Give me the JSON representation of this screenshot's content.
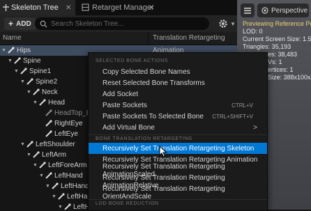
{
  "tabs": [
    {
      "label": "Skeleton Tree",
      "active": true
    },
    {
      "label": "Retarget Manager",
      "active": false
    }
  ],
  "toolbar": {
    "add_label": "ADD",
    "search_placeholder": "Search Skeleton Tree..."
  },
  "columns": {
    "name": "Name",
    "retarget": "Translation Retargeting"
  },
  "tree": [
    {
      "label": "Hips",
      "retarget": "Animation",
      "selected": true
    },
    {
      "label": "Spine",
      "retarget": ""
    },
    {
      "label": "Spine1",
      "retarget": ""
    },
    {
      "label": "Spine2",
      "retarget": ""
    },
    {
      "label": "Neck",
      "retarget": ""
    },
    {
      "label": "Head",
      "retarget": ""
    },
    {
      "label": "HeadTop_End",
      "retarget": ""
    },
    {
      "label": "RightEye",
      "retarget": ""
    },
    {
      "label": "LeftEye",
      "retarget": ""
    },
    {
      "label": "LeftShoulder",
      "retarget": ""
    },
    {
      "label": "LeftArm",
      "retarget": ""
    },
    {
      "label": "LeftForeArm",
      "retarget": ""
    },
    {
      "label": "LeftHand",
      "retarget": ""
    },
    {
      "label": "LeftHandMi",
      "retarget": ""
    },
    {
      "label": "LeftHandI",
      "retarget": ""
    },
    {
      "label": "LeftH",
      "retarget": ""
    }
  ],
  "viewport": {
    "perspective_label": "Perspective",
    "info": [
      "Previewing Reference Po",
      "LOD: 0",
      "Current Screen Size: 1.5",
      "Triangles: 35,193",
      "es: 38,483",
      "Vs: 1",
      "ertices: 1",
      "Size: 388x100x5"
    ]
  },
  "menu": {
    "section_selected": "SELECTED BONE ACTIONS",
    "items_selected": [
      {
        "label": "Copy Selected Bone Names",
        "shortcut": ""
      },
      {
        "label": "Reset Selected Bone Transforms",
        "shortcut": ""
      },
      {
        "label": "Add Socket",
        "shortcut": ""
      },
      {
        "label": "Paste Sockets",
        "shortcut": "CTRL+V"
      },
      {
        "label": "Paste Sockets To Selected Bone",
        "shortcut": "CTRL+SHIFT+V"
      },
      {
        "label": "Add Virtual Bone",
        "shortcut": "",
        "submenu_arrow": ">"
      }
    ],
    "section_translation": "BONE TRANSLATION RETARGETING",
    "items_translation": [
      {
        "label": "Recursively Set Translation Retargeting Skeleton",
        "highlighted": true
      },
      {
        "label": "Recursively Set Translation Retargeting Animation"
      },
      {
        "label": "Recursively Set Translation Retargeting AnimationScaled"
      },
      {
        "label": "Recursively Set Translation Retargeting AnimationRelative"
      },
      {
        "label": "Recursively Set Translation Retargeting OrientAndScale"
      }
    ],
    "section_lod": "LOD BONE REDUCTION"
  },
  "colors": {
    "accent": "#0078d4",
    "selected_row": "#3e4c5f"
  }
}
